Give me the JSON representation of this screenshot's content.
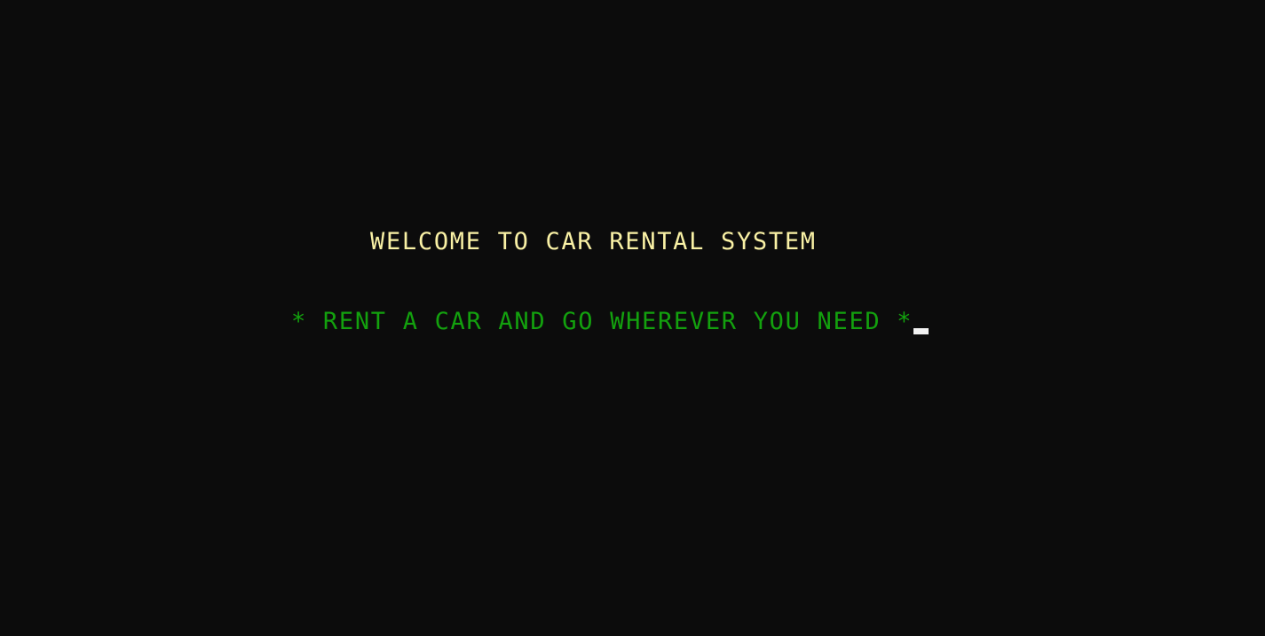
{
  "console": {
    "title": "WELCOME TO CAR RENTAL SYSTEM",
    "tagline": "* RENT A CAR AND GO WHEREVER YOU NEED *",
    "cursor_icon": "block-cursor"
  },
  "colors": {
    "background": "#0c0c0c",
    "title_text": "#f9f1a5",
    "tagline_text": "#13a10e",
    "cursor": "#f2f2f2"
  }
}
